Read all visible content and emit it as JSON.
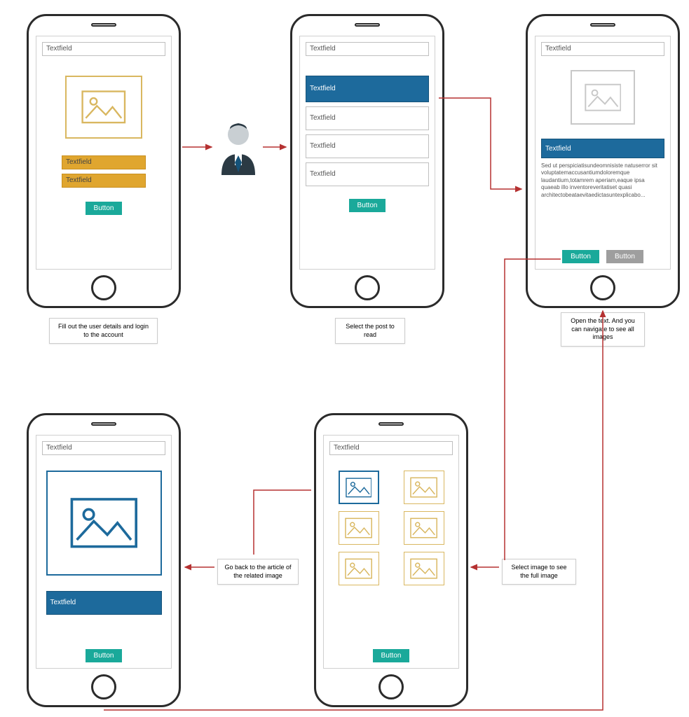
{
  "labels": {
    "textfield": "Textfield",
    "button": "Button"
  },
  "screen3": {
    "body": "Sed ut perspiciatisundeomnisiste natuserror sit voluptatemaccusantiumdoloremque laudantium,totamrem aperiam,eaque ipsa quaeab illo inventoreveritatiset quasi architectobeataevitaedictasuntexplicabo..."
  },
  "captions": {
    "c1": "Fill out the user details and login to the account",
    "c2": "Select the post to read",
    "c3": "Open the text. And you can navigate to see all images",
    "c4": "Select image to see the full image",
    "c5": "Go back to the article of the related image"
  },
  "colors": {
    "phoneFrame": "#2b2b2b",
    "accentBlue": "#1d6a9c",
    "accentAmber": "#e0a62f",
    "buttonTeal": "#1aa99a",
    "arrow": "#b53131"
  }
}
